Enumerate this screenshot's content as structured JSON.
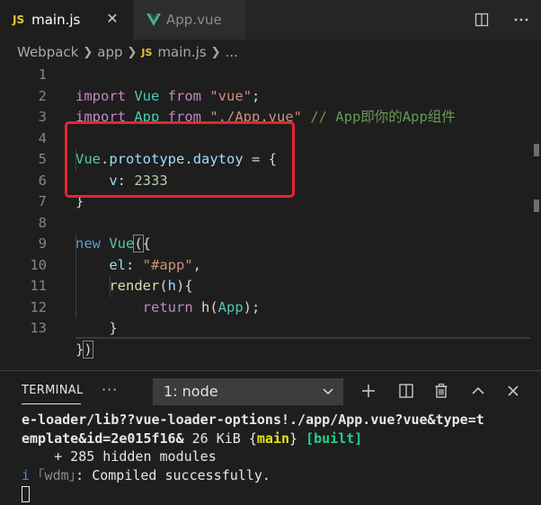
{
  "tabs": [
    {
      "icon": "JS",
      "label": "main.js",
      "close": "✕"
    },
    {
      "label": "App.vue"
    }
  ],
  "breadcrumb": {
    "items": [
      "Webpack",
      "app",
      "main.js",
      "..."
    ],
    "js_badge": "JS"
  },
  "editor": {
    "line_numbers": [
      "1",
      "2",
      "3",
      "4",
      "5",
      "6",
      "7",
      "8",
      "9",
      "10",
      "11",
      "12",
      "13"
    ],
    "lines": {
      "l1": {
        "t1": "import",
        "t2": " Vue ",
        "t3": "from",
        "t4": " \"vue\"",
        "t5": ";"
      },
      "l2": {
        "t1": "import",
        "t2": " App ",
        "t3": "from",
        "t4": " \"./App.vue\"",
        "t5": " // App即你的App组件"
      },
      "l4": {
        "t1": "Vue",
        "t2": ".",
        "t3": "prototype",
        "t4": ".",
        "t5": "daytoy",
        "t6": " = {"
      },
      "l5": {
        "t1": "    v",
        "t2": ": ",
        "t3": "2333"
      },
      "l6": {
        "t1": "}"
      },
      "l8": {
        "t1": "new",
        "t2": " Vue",
        "t3": "(",
        "t4": "{"
      },
      "l9": {
        "t1": "    el",
        "t2": ": ",
        "t3": "\"#app\"",
        "t4": ","
      },
      "l10": {
        "t1": "    render",
        "t2": "(",
        "t3": "h",
        "t4": "){"
      },
      "l11": {
        "t1": "        return",
        "t2": " h",
        "t3": "(",
        "t4": "App",
        "t5": ");"
      },
      "l12": {
        "t1": "    }"
      },
      "l13": {
        "t1": "}",
        "t2": ")"
      }
    }
  },
  "panel": {
    "title": "TERMINAL",
    "more": "···",
    "terminal_select": "1: node",
    "terminal_lines": {
      "l1": "e-loader/lib??vue-loader-options!./app/App.vue?vue&type=t",
      "l2a": "emplate&id=2e015f16&",
      "l2b": " 26 KiB ",
      "l2c": "{",
      "l2d": "main",
      "l2e": "}",
      "l2f": " [built]",
      "l3": "    + 285 hidden modules",
      "l4a": "i",
      "l4b": " ｢wdm｣",
      "l4c": ": Compiled successfully."
    }
  },
  "colors": {
    "js_badge": "#e8c33a",
    "vue_green": "#41b883",
    "highlight_box": "#e8242d"
  }
}
